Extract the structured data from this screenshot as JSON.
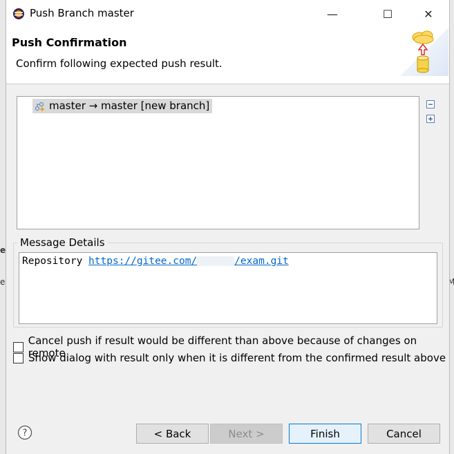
{
  "dialog": {
    "title": "Push Branch master",
    "window_controls": {
      "minimize": "—",
      "maximize": "☐",
      "close": "✕"
    }
  },
  "banner": {
    "title": "Push Confirmation",
    "subtitle": "Confirm following expected push result.",
    "graphic_icon": "push-to-cloud-icon"
  },
  "tree": {
    "rows": [
      {
        "label": "master → master [new branch]",
        "icon": "branch-new-icon"
      }
    ],
    "collapse_icon": "collapse-all-icon",
    "expand_icon": "expand-all-icon"
  },
  "message_details": {
    "legend": "Message Details",
    "label": "Repository",
    "url_start": "https://gitee.com/",
    "url_end": "/exam.git"
  },
  "options": {
    "cancel_push_label": "Cancel push if result would be different than above because of changes on remote",
    "cancel_push_checked": false,
    "show_dialog_label": "Show dialog with result only when it is different from the confirmed result above",
    "show_dialog_checked": false
  },
  "buttons": {
    "back": "< Back",
    "next": "Next >",
    "finish": "Finish",
    "cancel": "Cancel",
    "help_icon": "help-icon"
  },
  "background": {
    "left_peek_1": "e",
    "left_peek_2": "es",
    "right_peek": "M"
  },
  "colors": {
    "link": "#0066cc",
    "default_button_border": "#0078d7",
    "selection": "#d9d9d9"
  }
}
